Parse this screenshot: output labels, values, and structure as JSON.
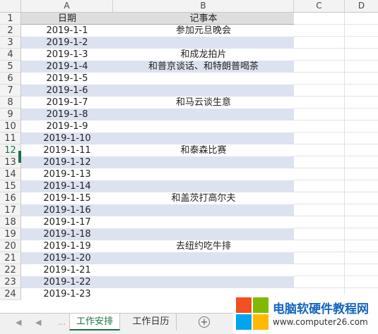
{
  "columns": [
    "A",
    "B",
    "C",
    "D"
  ],
  "headers": {
    "date": "日期",
    "note": "记事本"
  },
  "rows": [
    {
      "num": "1"
    },
    {
      "num": "2",
      "date": "2019-1-1",
      "note": "参加元旦晚会"
    },
    {
      "num": "3",
      "date": "2019-1-2",
      "note": ""
    },
    {
      "num": "4",
      "date": "2019-1-3",
      "note": "和成龙拍片"
    },
    {
      "num": "5",
      "date": "2019-1-4",
      "note": "和普京谈话、和特朗普喝茶"
    },
    {
      "num": "6",
      "date": "2019-1-5",
      "note": ""
    },
    {
      "num": "7",
      "date": "2019-1-6",
      "note": ""
    },
    {
      "num": "8",
      "date": "2019-1-7",
      "note": "和马云谈生意"
    },
    {
      "num": "9",
      "date": "2019-1-8",
      "note": ""
    },
    {
      "num": "10",
      "date": "2019-1-9",
      "note": ""
    },
    {
      "num": "11",
      "date": "2019-1-10",
      "note": ""
    },
    {
      "num": "12",
      "date": "2019-1-11",
      "note": "和泰森比赛"
    },
    {
      "num": "13",
      "date": "2019-1-12",
      "note": ""
    },
    {
      "num": "14",
      "date": "2019-1-13",
      "note": ""
    },
    {
      "num": "15",
      "date": "2019-1-14",
      "note": ""
    },
    {
      "num": "16",
      "date": "2019-1-15",
      "note": "和盖茨打高尔夫"
    },
    {
      "num": "17",
      "date": "2019-1-16",
      "note": ""
    },
    {
      "num": "18",
      "date": "2019-1-17",
      "note": ""
    },
    {
      "num": "19",
      "date": "2019-1-18",
      "note": ""
    },
    {
      "num": "20",
      "date": "2019-1-19",
      "note": "去纽约吃牛排"
    },
    {
      "num": "21",
      "date": "2019-1-20",
      "note": ""
    },
    {
      "num": "22",
      "date": "2019-1-21",
      "note": ""
    },
    {
      "num": "23",
      "date": "2019-1-22",
      "note": ""
    },
    {
      "num": "24",
      "date": "2019-1-23",
      "note": ""
    }
  ],
  "active_row": "12",
  "tabs": {
    "active": "工作安排",
    "other": "工作日历",
    "add": "+"
  },
  "nav_icons": [
    "first-sheet-icon",
    "prev-sheet-icon",
    "next-sheet-icon"
  ],
  "watermark": {
    "title": "电脑软硬件教程网",
    "url": "www.computer26.com"
  },
  "colors": {
    "accent": "#1e7145",
    "band": "#dce2f0",
    "header_fill": "#dedede",
    "watermark_title": "#1565c0"
  }
}
